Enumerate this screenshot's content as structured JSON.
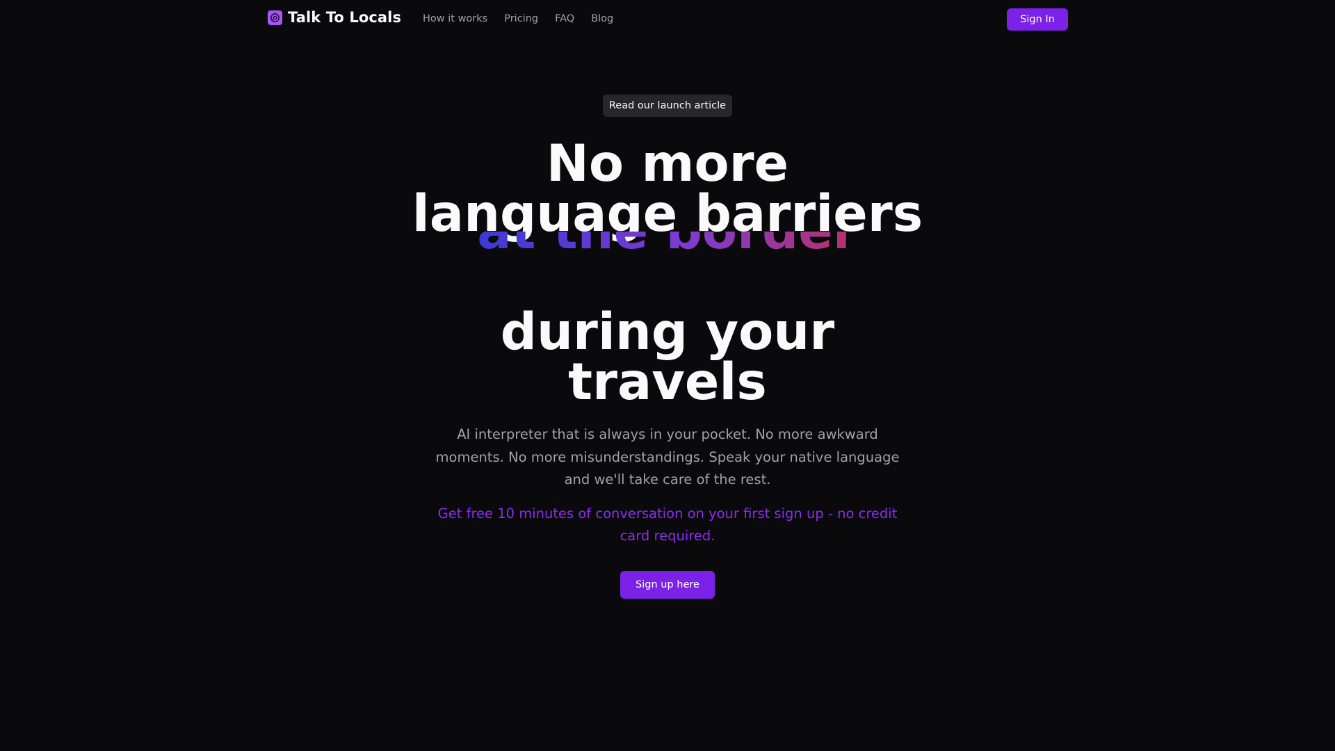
{
  "nav": {
    "brand": "Talk To Locals",
    "brand_icon": "globe-chat-icon",
    "links": [
      "How it works",
      "Pricing",
      "FAQ",
      "Blog"
    ],
    "signin_label": "Sign In"
  },
  "hero": {
    "launch_badge": "Read our launch article",
    "headline_line1": "No more",
    "headline_line2": "language barriers",
    "rotating_phrase": "at the border",
    "headline_line4": "during your",
    "headline_line5": "travels",
    "description": "AI interpreter that is always in your pocket. No more awkward moments. No more misunderstandings. Speak your native language and we'll take care of the rest.",
    "promo": "Get free 10 minutes of conversation on your first sign up - no credit card required.",
    "cta_label": "Sign up here"
  },
  "colors": {
    "background": "#0a0a0c",
    "accent": "#7c22e8",
    "promo_text": "#8b2cf5",
    "gradient": [
      "#3b3ad6",
      "#7e3bd0",
      "#b8316a"
    ]
  }
}
